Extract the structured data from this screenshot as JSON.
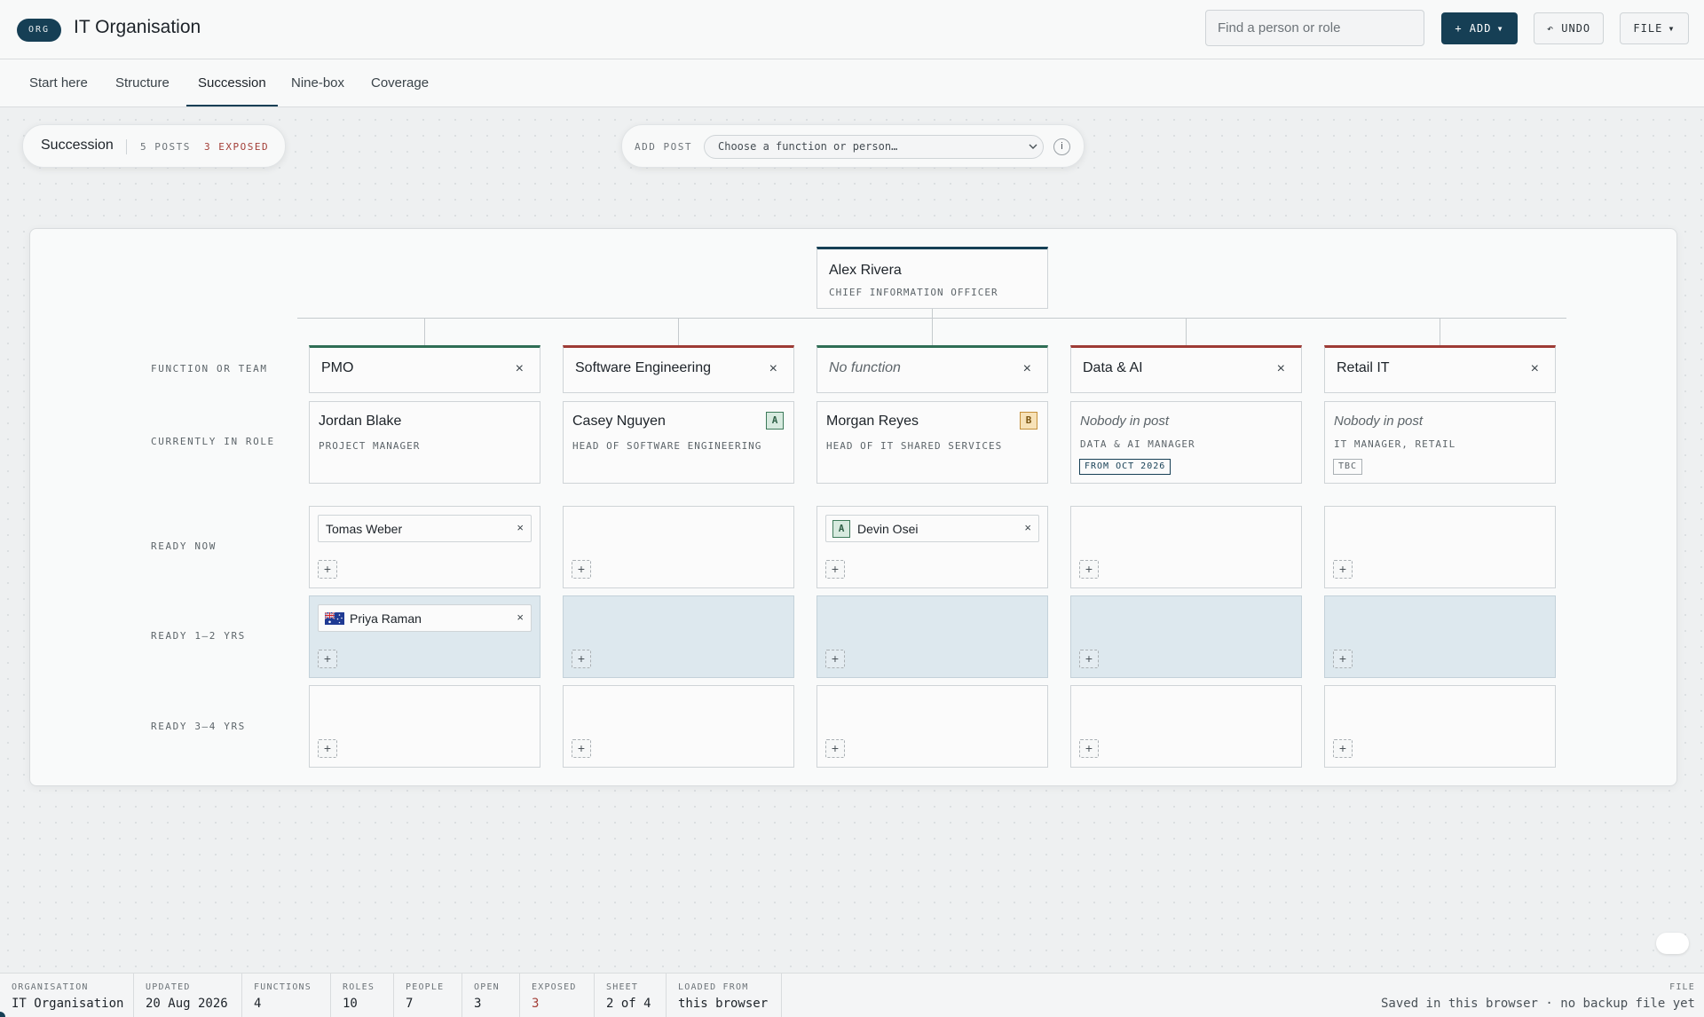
{
  "header": {
    "badge": "ORG",
    "title": "IT Organisation",
    "search_placeholder": "Find a person or role",
    "add_label": "+ ADD",
    "undo_label": "↶ UNDO",
    "file_label": "FILE"
  },
  "tabs": [
    {
      "label": "Start here",
      "active": false
    },
    {
      "label": "Structure",
      "active": false
    },
    {
      "label": "Succession",
      "active": true
    },
    {
      "label": "Nine-box",
      "active": false
    },
    {
      "label": "Coverage",
      "active": false
    }
  ],
  "summary": {
    "title": "Succession",
    "posts": "5 POSTS",
    "exposed": "3 EXPOSED"
  },
  "add_post": {
    "label": "ADD POST",
    "placeholder": "Choose a function or person…",
    "info": "i"
  },
  "root": {
    "name": "Alex Rivera",
    "role": "CHIEF INFORMATION OFFICER"
  },
  "row_labels": {
    "function": "FUNCTION OR TEAM",
    "current": "CURRENTLY IN ROLE",
    "ready_now": "READY NOW",
    "ready_1_2": "READY 1–2 YRS",
    "ready_3_4": "READY 3–4 YRS"
  },
  "columns": [
    {
      "function": "PMO",
      "function_status": "covered",
      "holder": "Jordan Blake",
      "role": "PROJECT MANAGER",
      "ready_now": "Tomas Weber",
      "ready_1_2": "Priya Raman"
    },
    {
      "function": "Software Engineering",
      "function_status": "exposed",
      "holder": "Casey Nguyen",
      "role": "HEAD OF SOFTWARE ENGINEERING",
      "grade": "A"
    },
    {
      "function": "No function",
      "function_status": "covered",
      "holder": "Morgan Reyes",
      "role": "HEAD OF IT SHARED SERVICES",
      "grade": "B",
      "ready_now": "Devin Osei",
      "ready_now_grade": "A"
    },
    {
      "function": "Data & AI",
      "function_status": "exposed",
      "holder": "Nobody in post",
      "role": "DATA & AI MANAGER",
      "tag": "FROM OCT 2026"
    },
    {
      "function": "Retail IT",
      "function_status": "exposed",
      "holder": "Nobody in post",
      "role": "IT MANAGER, RETAIL",
      "tag": "TBC"
    }
  ],
  "status_bar": {
    "organisation": {
      "label": "ORGANISATION",
      "value": "IT Organisation"
    },
    "updated": {
      "label": "UPDATED",
      "value": "20 Aug 2026"
    },
    "functions": {
      "label": "FUNCTIONS",
      "value": "4"
    },
    "roles": {
      "label": "ROLES",
      "value": "10"
    },
    "people": {
      "label": "PEOPLE",
      "value": "7"
    },
    "open": {
      "label": "OPEN",
      "value": "3"
    },
    "exposed": {
      "label": "EXPOSED",
      "value": "3"
    },
    "sheet": {
      "label": "SHEET",
      "value": "2 of 4"
    },
    "loaded_from": {
      "label": "LOADED FROM",
      "value": "this browser"
    },
    "file": {
      "label": "FILE",
      "value": "Saved in this browser · no backup file yet"
    }
  },
  "colors": {
    "primary": "#163f55",
    "covered": "#2f6e55",
    "exposed": "#9e3b35",
    "shade": "#dde8ee"
  },
  "icons": {
    "close": "×",
    "add": "+",
    "dropdown": "▾"
  }
}
